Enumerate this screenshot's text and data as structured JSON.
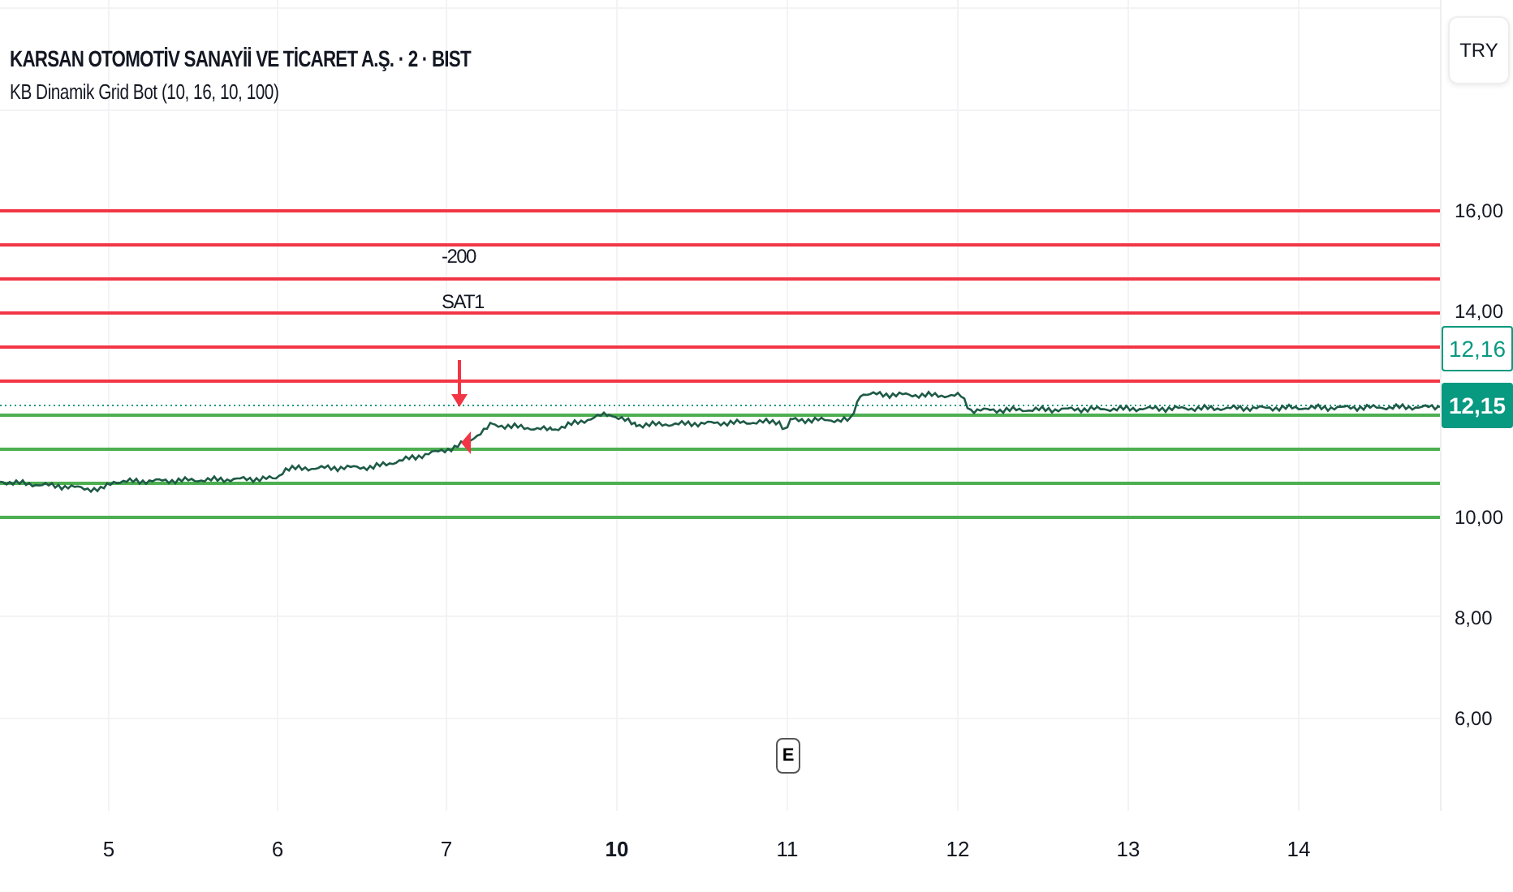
{
  "header": {
    "title": "KARSAN OTOMOTİV SANAYİİ VE TİCARET A.Ş. · 2 · BIST",
    "indicator": "KB Dinamik Grid Bot (10, 16, 10, 100)"
  },
  "currency_button": "TRY",
  "grid_lines": [
    {
      "color": "#f23645"
    },
    {
      "color": "#f23645"
    },
    {
      "color": "#f23645"
    },
    {
      "color": "#f23645"
    },
    {
      "color": "#f23645"
    },
    {
      "color": "#f23645"
    },
    {
      "color": "#4caf50"
    },
    {
      "color": "#4caf50"
    },
    {
      "color": "#4caf50"
    },
    {
      "color": "#4caf50"
    }
  ],
  "signal": {
    "quantity": "-200",
    "label": "SAT1"
  },
  "event_badge": "E",
  "price_axis": [
    "16,00",
    "14,00",
    "10,00",
    "8,00",
    "6,00"
  ],
  "price_tags": [
    {
      "text": "12,16",
      "kind": "outline"
    },
    {
      "text": "12,15",
      "kind": "filled"
    }
  ],
  "time_axis": [
    {
      "label": "5",
      "bold": false
    },
    {
      "label": "6",
      "bold": false
    },
    {
      "label": "7",
      "bold": false
    },
    {
      "label": "10",
      "bold": true
    },
    {
      "label": "11",
      "bold": false
    },
    {
      "label": "12",
      "bold": false
    },
    {
      "label": "13",
      "bold": false
    },
    {
      "label": "14",
      "bold": false
    }
  ]
}
